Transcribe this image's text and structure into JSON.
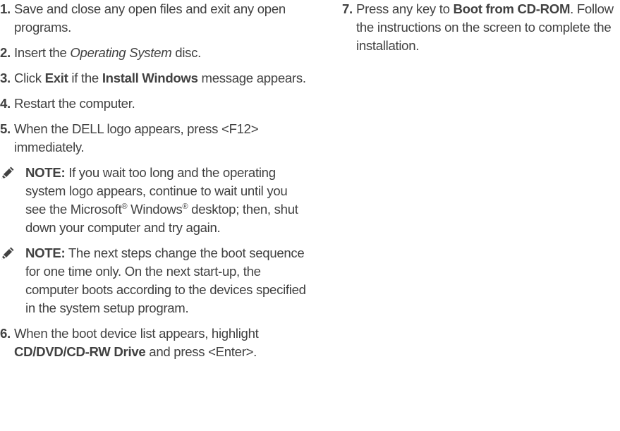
{
  "left": {
    "step1": {
      "num": "1.",
      "text": "Save and close any open files and exit any open programs."
    },
    "step2": {
      "num": "2.",
      "pre": "Insert the ",
      "em": "Operating System",
      "post": " disc."
    },
    "step3": {
      "num": "3.",
      "pre": "Click ",
      "b1": "Exit",
      "mid": " if the ",
      "b2": "Install Windows",
      "post": " message appears."
    },
    "step4": {
      "num": "4.",
      "text": "Restart the computer."
    },
    "step5": {
      "num": "5.",
      "text": "When the DELL logo appears, press <F12> immediately."
    },
    "note1": {
      "title": "NOTE:",
      "pre": " If you wait too long and the operating system logo appears, continue to wait until you see the Microsoft",
      "reg1": "®",
      "mid": " Windows",
      "reg2": "®",
      "post": " desktop; then, shut down your computer and try again."
    },
    "note2": {
      "title": "NOTE:",
      "text": " The next steps change the boot sequence for one time only. On the next start-up, the computer boots according to the devices specified in the system setup program."
    },
    "step6": {
      "num": "6.",
      "pre": "When the boot device list appears, highlight ",
      "b1": "CD/DVD/CD-RW Drive",
      "post": " and press <Enter>."
    }
  },
  "right": {
    "step7": {
      "num": "7.",
      "pre": "Press any key to ",
      "b1": "Boot from CD-ROM",
      "post": ". Follow the instructions on the screen to complete the installation."
    }
  },
  "icons": {
    "note": "pencil-note-icon"
  },
  "colors": {
    "text": "#414141"
  }
}
